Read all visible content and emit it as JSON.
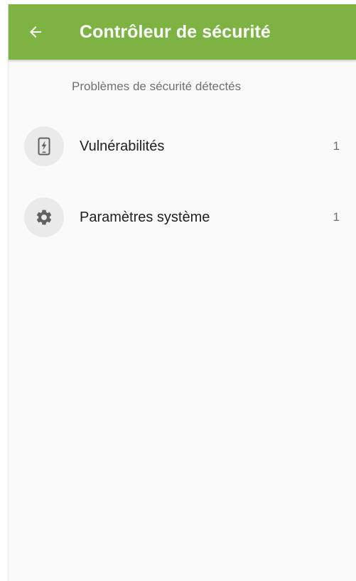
{
  "appbar": {
    "title": "Contrôleur de sécurité",
    "back_icon": "arrow-left-icon",
    "color": "#7cb342"
  },
  "section": {
    "header": "Problèmes de sécurité détectés"
  },
  "items": [
    {
      "label": "Vulnérabilités",
      "count": "1",
      "icon": "phone-alert-icon"
    },
    {
      "label": "Paramètres système",
      "count": "1",
      "icon": "gear-icon"
    }
  ]
}
